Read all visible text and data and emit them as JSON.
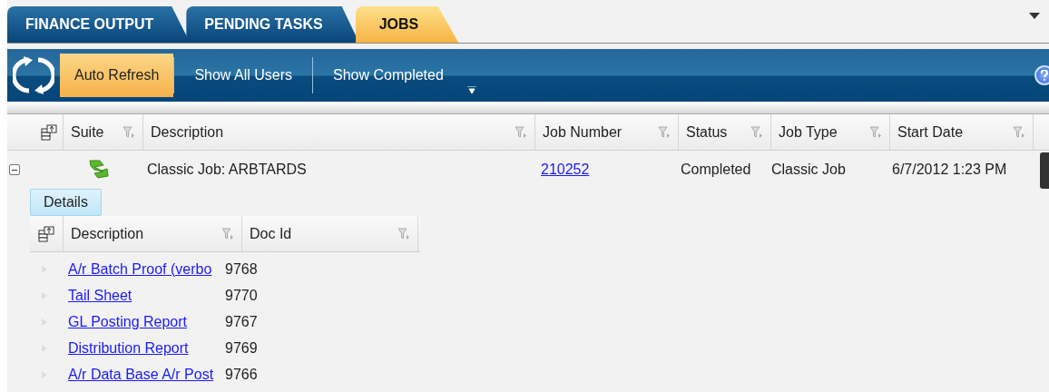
{
  "tabs": [
    {
      "label": "FINANCE OUTPUT",
      "selected": false
    },
    {
      "label": "PENDING TASKS",
      "selected": false
    },
    {
      "label": "JOBS",
      "selected": true
    }
  ],
  "toolbar": {
    "toggles": [
      {
        "label": "Auto Refresh",
        "on": true
      },
      {
        "label": "Show All Users",
        "on": false
      },
      {
        "label": "Show Completed",
        "on": false
      }
    ]
  },
  "jobs_table": {
    "columns": [
      "Suite",
      "Description",
      "Job Number",
      "Status",
      "Job Type",
      "Start Date"
    ],
    "rows": [
      {
        "expanded": true,
        "description": "Classic Job: ARBTARDS",
        "job_number": "210252",
        "status": "Completed",
        "job_type": "Classic Job",
        "start_date": "6/7/2012 1:23 PM",
        "details": {
          "tab": "Details",
          "columns": [
            "Description",
            "Doc Id"
          ],
          "rows": [
            {
              "description": "A/r Batch Proof (verbo",
              "doc_id": "9768"
            },
            {
              "description": "Tail Sheet",
              "doc_id": "9770"
            },
            {
              "description": "GL Posting Report",
              "doc_id": "9767"
            },
            {
              "description": "Distribution Report",
              "doc_id": "9769"
            },
            {
              "description": "A/r Data Base A/r Post",
              "doc_id": "9766"
            }
          ]
        }
      }
    ]
  }
}
